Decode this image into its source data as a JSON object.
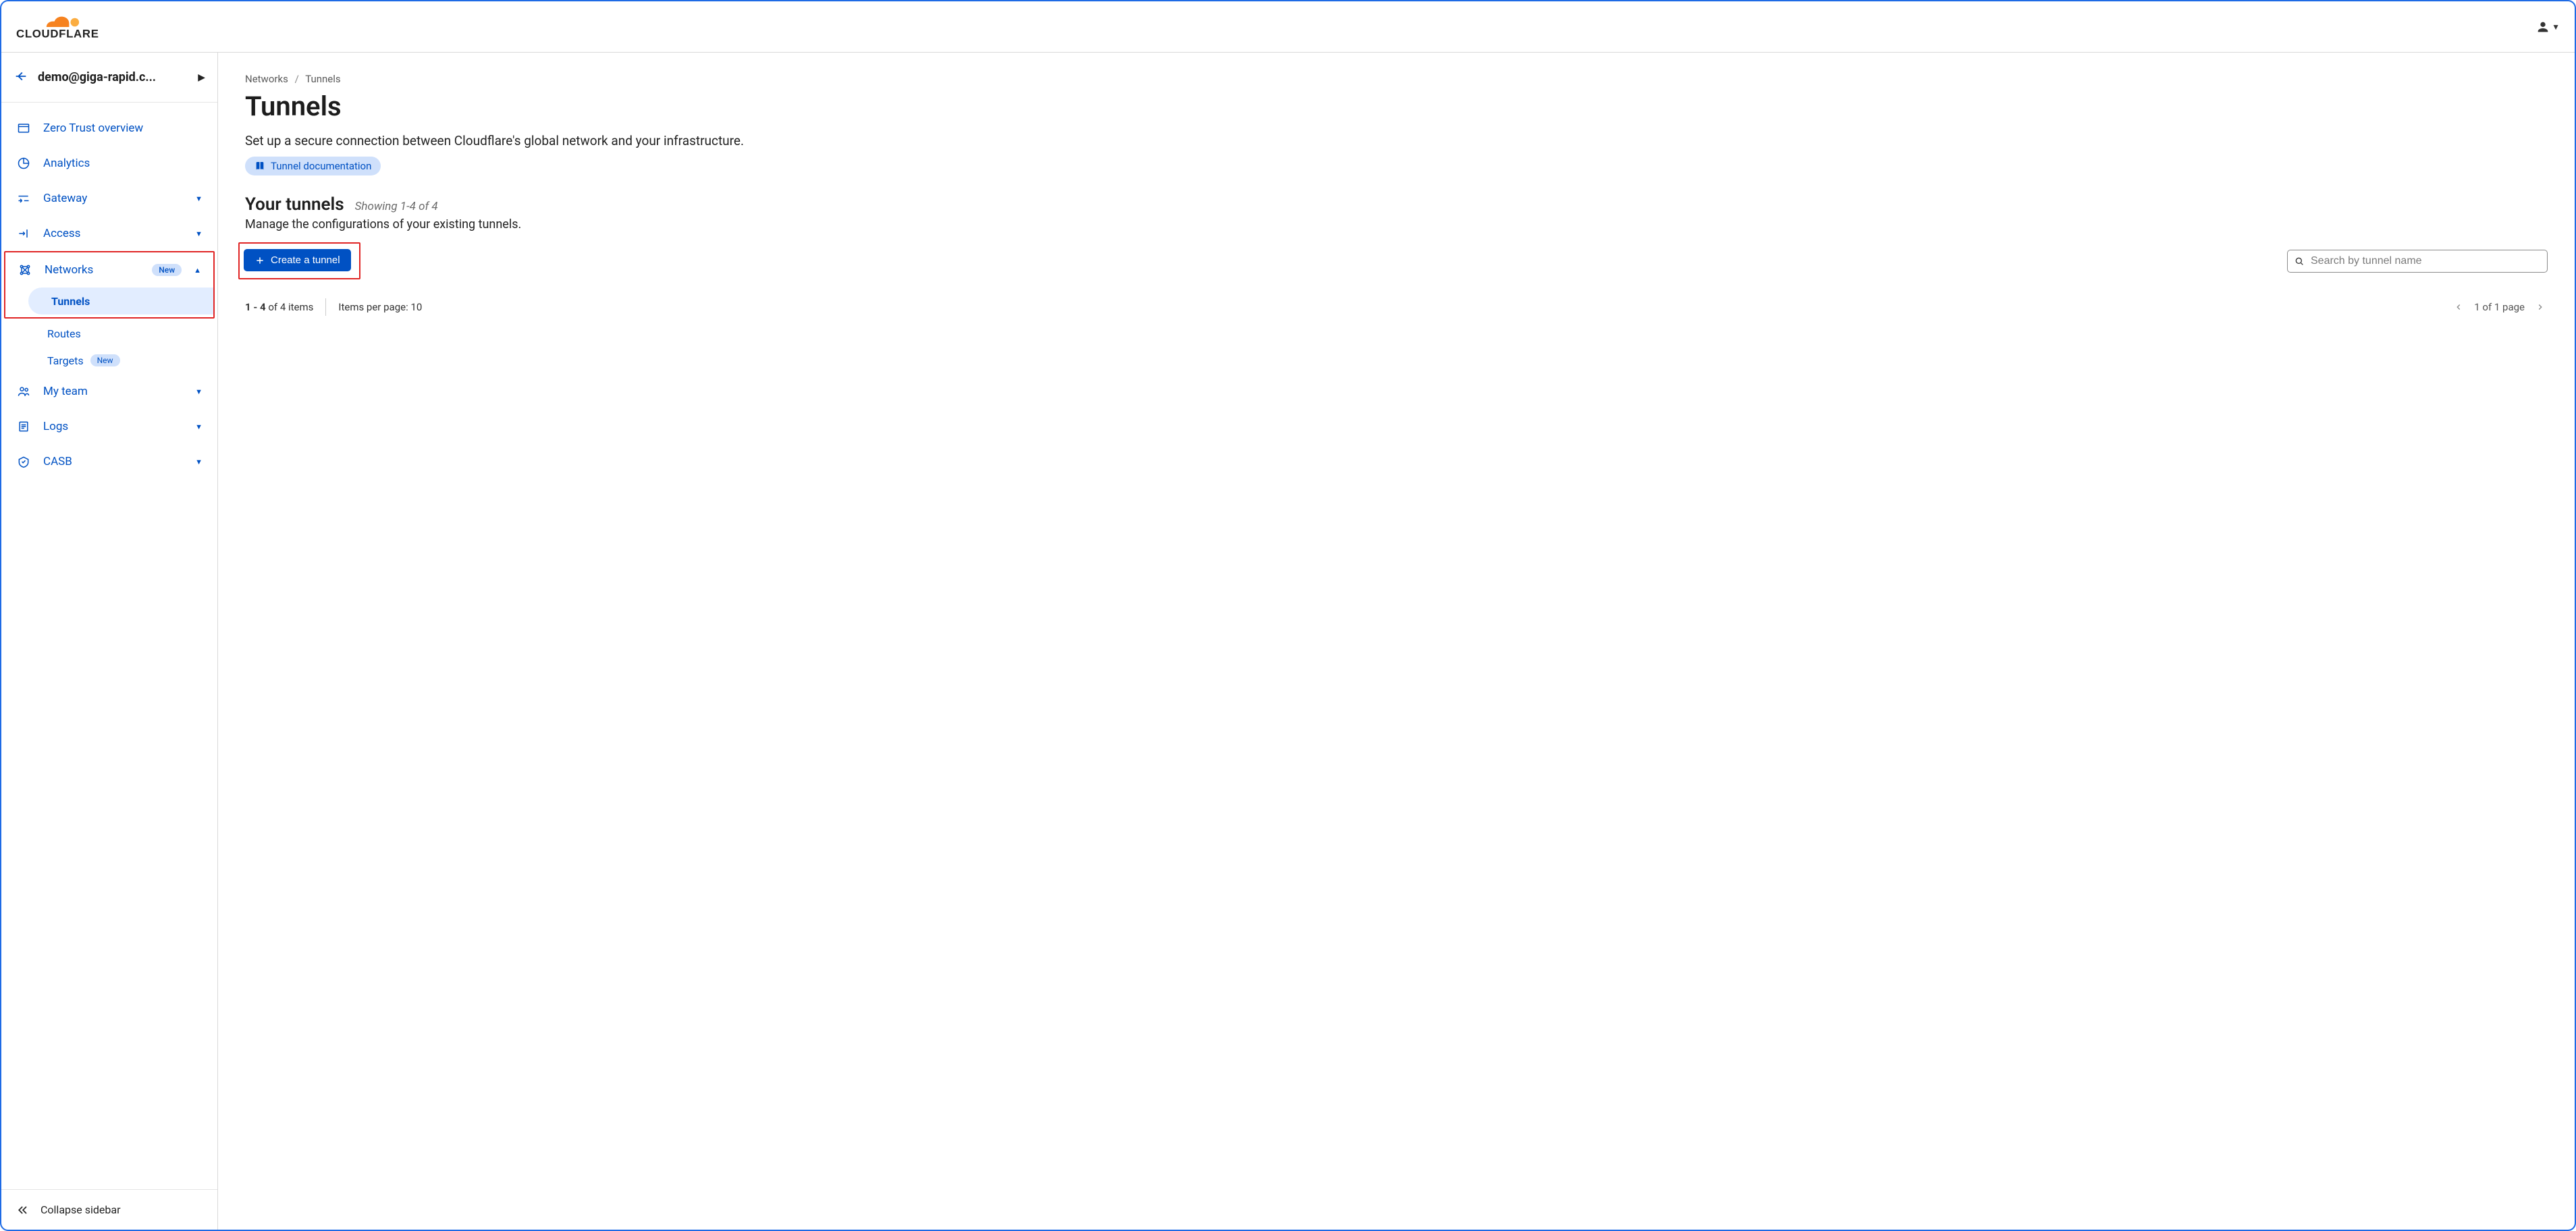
{
  "brand": "CLOUDFLARE",
  "account": {
    "label": "demo@giga-rapid.c..."
  },
  "sidebar": {
    "overview": "Zero Trust overview",
    "analytics": "Analytics",
    "gateway": "Gateway",
    "access": "Access",
    "networks": {
      "label": "Networks",
      "badge": "New"
    },
    "networks_sub": {
      "tunnels": "Tunnels",
      "routes": "Routes",
      "targets": {
        "label": "Targets",
        "badge": "New"
      }
    },
    "myteam": "My team",
    "logs": "Logs",
    "casb": "CASB",
    "collapse": "Collapse sidebar"
  },
  "breadcrumb": {
    "a": "Networks",
    "b": "Tunnels"
  },
  "page": {
    "title": "Tunnels",
    "lead": "Set up a secure connection between Cloudflare's global network and your infrastructure.",
    "doc_chip": "Tunnel documentation"
  },
  "section": {
    "heading": "Your tunnels",
    "showing": "Showing 1-4 of 4",
    "desc": "Manage the configurations of your existing tunnels."
  },
  "actions": {
    "create_label": "Create a tunnel",
    "search_placeholder": "Search by tunnel name"
  },
  "pager": {
    "range_bold": "1 - 4",
    "range_rest": "of 4 items",
    "ipp": "Items per page: 10",
    "page_text": "1 of 1 page"
  }
}
